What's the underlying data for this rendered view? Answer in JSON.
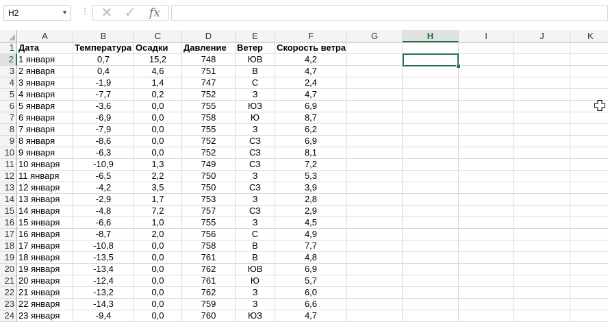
{
  "name_box": {
    "value": "H2"
  },
  "formula_bar": {
    "dots": "⋮",
    "cancel_glyph": "✕",
    "enter_glyph": "✓",
    "fx_label": "fx",
    "value": ""
  },
  "columns": [
    "A",
    "B",
    "C",
    "D",
    "E",
    "F",
    "G",
    "H",
    "I",
    "J",
    "K"
  ],
  "selected_column": "H",
  "selected_row": 2,
  "header_row": [
    "Дата",
    "Температура",
    "Осадки",
    "Давление",
    "Ветер",
    "Скорость ветра"
  ],
  "rows": [
    [
      "1 января",
      "0,7",
      "15,2",
      "748",
      "ЮВ",
      "4,2"
    ],
    [
      "2 января",
      "0,4",
      "4,6",
      "751",
      "В",
      "4,7"
    ],
    [
      "3 января",
      "-1,9",
      "1,4",
      "747",
      "С",
      "2,4"
    ],
    [
      "4 января",
      "-7,7",
      "0,2",
      "752",
      "З",
      "4,7"
    ],
    [
      "5 января",
      "-3,6",
      "0,0",
      "755",
      "ЮЗ",
      "6,9"
    ],
    [
      "6 января",
      "-6,9",
      "0,0",
      "758",
      "Ю",
      "8,7"
    ],
    [
      "7 января",
      "-7,9",
      "0,0",
      "755",
      "З",
      "6,2"
    ],
    [
      "8 января",
      "-8,6",
      "0,0",
      "752",
      "СЗ",
      "6,9"
    ],
    [
      "9 января",
      "-6,3",
      "0,0",
      "752",
      "СЗ",
      "8,1"
    ],
    [
      "10 января",
      "-10,9",
      "1,3",
      "749",
      "СЗ",
      "7,2"
    ],
    [
      "11 января",
      "-6,5",
      "2,2",
      "750",
      "З",
      "5,3"
    ],
    [
      "12 января",
      "-4,2",
      "3,5",
      "750",
      "СЗ",
      "3,9"
    ],
    [
      "13 января",
      "-2,9",
      "1,7",
      "753",
      "З",
      "2,8"
    ],
    [
      "14 января",
      "-4,8",
      "7,2",
      "757",
      "СЗ",
      "2,9"
    ],
    [
      "15 января",
      "-6,6",
      "1,0",
      "755",
      "З",
      "4,5"
    ],
    [
      "16 января",
      "-8,7",
      "2,0",
      "756",
      "С",
      "4,9"
    ],
    [
      "17 января",
      "-10,8",
      "0,0",
      "758",
      "В",
      "7,7"
    ],
    [
      "18 января",
      "-13,5",
      "0,0",
      "761",
      "В",
      "4,8"
    ],
    [
      "19 января",
      "-13,4",
      "0,0",
      "762",
      "ЮВ",
      "6,9"
    ],
    [
      "20 января",
      "-12,4",
      "0,0",
      "761",
      "Ю",
      "5,7"
    ],
    [
      "21 января",
      "-13,2",
      "0,0",
      "762",
      "З",
      "6,0"
    ],
    [
      "22 января",
      "-14,3",
      "0,0",
      "759",
      "З",
      "6,6"
    ],
    [
      "23 января",
      "-9,4",
      "0,0",
      "760",
      "ЮЗ",
      "4,7"
    ]
  ],
  "colors": {
    "accent": "#217346",
    "gridline": "#d9d9d9",
    "header_bg": "#f4f4f4"
  },
  "icons": {
    "cursor": "plus-cursor-icon"
  }
}
